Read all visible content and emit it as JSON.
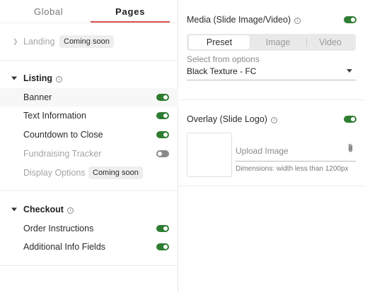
{
  "tabs": {
    "global": "Global",
    "pages": "Pages"
  },
  "landing": {
    "label": "Landing",
    "badge": "Coming soon"
  },
  "listing": {
    "title": "Listing",
    "items": [
      {
        "label": "Banner",
        "toggle": "on"
      },
      {
        "label": "Text Information",
        "toggle": "on"
      },
      {
        "label": "Countdown to Close",
        "toggle": "on"
      },
      {
        "label": "Fundraising Tracker",
        "toggle": "off"
      }
    ],
    "display_options": {
      "label": "Display Options",
      "badge": "Coming soon"
    }
  },
  "checkout": {
    "title": "Checkout",
    "items": [
      {
        "label": "Order Instructions",
        "toggle": "on"
      },
      {
        "label": "Additional Info Fields",
        "toggle": "on"
      }
    ]
  },
  "media": {
    "title": "Media (Slide Image/Video)",
    "toggle": "on",
    "segments": [
      "Preset",
      "Image",
      "Video"
    ],
    "active_segment": "Preset",
    "select_label": "Select from options",
    "select_value": "Black Texture - FC"
  },
  "overlay": {
    "title": "Overlay (Slide Logo)",
    "toggle": "on",
    "upload_label": "Upload Image",
    "hint": "Dimensions: width less than 1200px"
  },
  "colors": {
    "accent": "#d9534f",
    "toggle_on": "#2e7d32",
    "toggle_off": "#8a8a8a"
  },
  "icons": [
    "info-icon",
    "chevron-right-icon",
    "caret-down-icon",
    "paperclip-icon"
  ]
}
